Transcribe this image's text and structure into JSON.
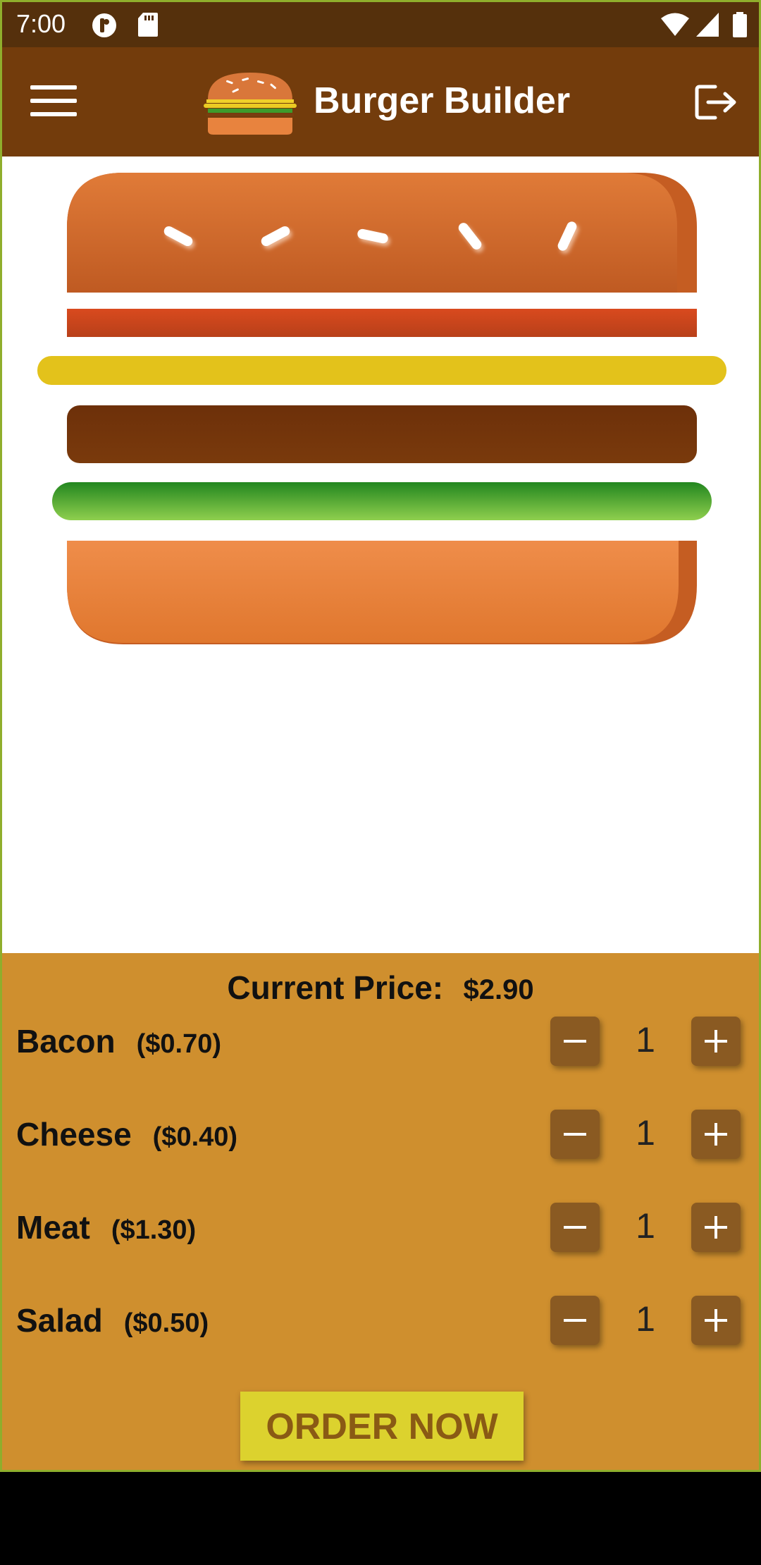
{
  "status_bar": {
    "time": "7:00",
    "icons": [
      "app-notification-icon",
      "sd-card-icon",
      "wifi-icon",
      "cell-signal-icon",
      "battery-icon"
    ]
  },
  "app_bar": {
    "title": "Burger Builder",
    "menu_icon": "hamburger-menu-icon",
    "logo": "burger-logo",
    "logout_icon": "logout-icon"
  },
  "burger": {
    "layers": [
      "bread-top",
      "bacon",
      "cheese",
      "meat",
      "salad",
      "bread-bottom"
    ]
  },
  "controls": {
    "price_label": "Current Price:",
    "price_value": "$2.90",
    "ingredients": [
      {
        "name": "Bacon",
        "price": "($0.70)",
        "qty": "1"
      },
      {
        "name": "Cheese",
        "price": "($0.40)",
        "qty": "1"
      },
      {
        "name": "Meat",
        "price": "($1.30)",
        "qty": "1"
      },
      {
        "name": "Salad",
        "price": "($0.50)",
        "qty": "1"
      }
    ],
    "order_label": "ORDER NOW"
  },
  "colors": {
    "status_bar": "#55300c",
    "app_bar": "#733c0c",
    "controls_bg": "#cf8f2e",
    "control_button": "#8a5a22",
    "order_button": "#dcd22e"
  }
}
